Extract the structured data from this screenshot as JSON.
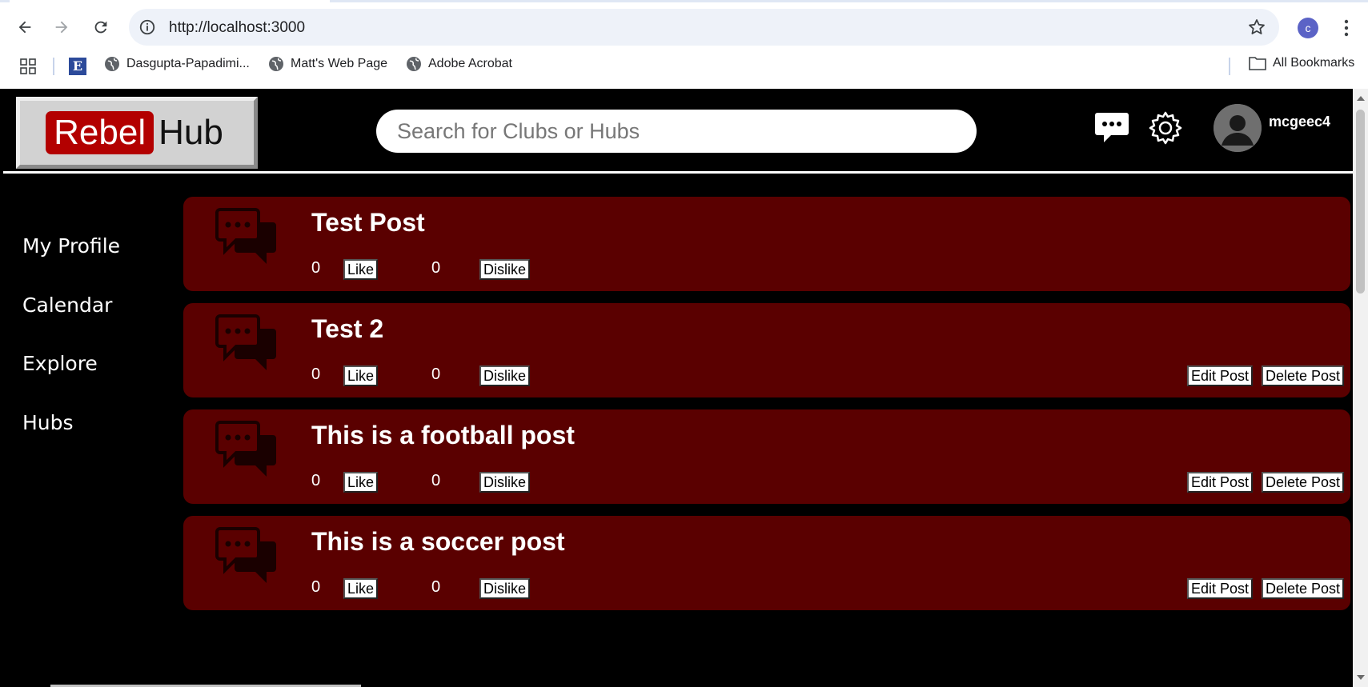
{
  "browser": {
    "url": "http://localhost:3000",
    "profile_initial": "c",
    "bookmarks": [
      {
        "label": "Dasgupta-Papadimi..."
      },
      {
        "label": "Matt's Web Page"
      },
      {
        "label": "Adobe Acrobat"
      }
    ],
    "all_bookmarks_label": "All Bookmarks"
  },
  "header": {
    "logo_part1": "Rebel",
    "logo_part2": "Hub",
    "search_placeholder": "Search for Clubs or Hubs",
    "username": "mcgeec4"
  },
  "sidebar": {
    "items": [
      {
        "label": "My Profile"
      },
      {
        "label": "Calendar"
      },
      {
        "label": "Explore"
      },
      {
        "label": "Hubs"
      }
    ]
  },
  "posts": [
    {
      "title": "Test Post",
      "likes": "0",
      "dislikes": "0",
      "like_label": "Like",
      "dislike_label": "Dislike"
    },
    {
      "title": "Test 2",
      "likes": "0",
      "dislikes": "0",
      "like_label": "Like",
      "dislike_label": "Dislike",
      "edit_label": "Edit Post",
      "delete_label": "Delete Post"
    },
    {
      "title": "This is a football post",
      "likes": "0",
      "dislikes": "0",
      "like_label": "Like",
      "dislike_label": "Dislike",
      "edit_label": "Edit Post",
      "delete_label": "Delete Post"
    },
    {
      "title": "This is a soccer post",
      "likes": "0",
      "dislikes": "0",
      "like_label": "Like",
      "dislike_label": "Dislike",
      "edit_label": "Edit Post",
      "delete_label": "Delete Post"
    }
  ],
  "colors": {
    "post_background": "#5a0000",
    "logo_red": "#b30000",
    "page_background": "#000000"
  }
}
